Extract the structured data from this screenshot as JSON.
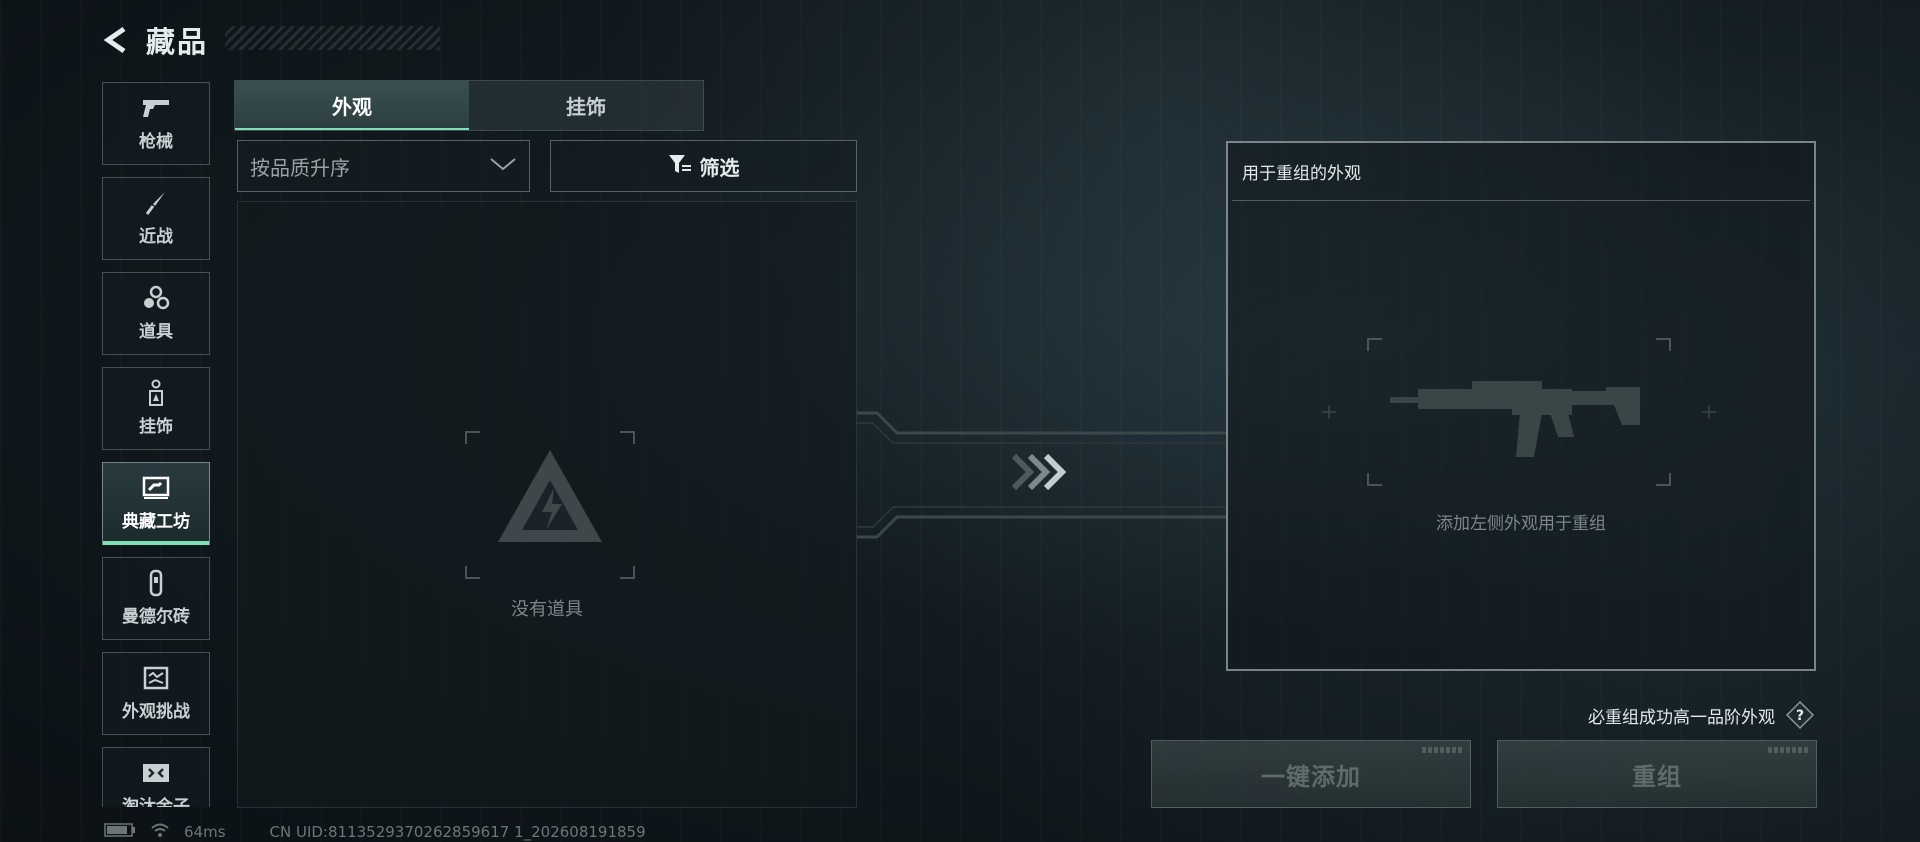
{
  "header": {
    "title": "藏品"
  },
  "sidebar": {
    "items": [
      {
        "label": "枪械",
        "icon": "pistol-icon"
      },
      {
        "label": "近战",
        "icon": "knife-icon"
      },
      {
        "label": "道具",
        "icon": "grenade-icon"
      },
      {
        "label": "挂饰",
        "icon": "charm-icon"
      },
      {
        "label": "典藏工坊",
        "icon": "workshop-icon",
        "active": true
      },
      {
        "label": "曼德尔砖",
        "icon": "brick-icon"
      },
      {
        "label": "外观挑战",
        "icon": "challenge-icon"
      },
      {
        "label": "淘汰余子",
        "icon": "elimination-icon"
      }
    ]
  },
  "tabs": [
    {
      "label": "外观",
      "active": true
    },
    {
      "label": "挂饰",
      "active": false
    }
  ],
  "sort": {
    "value": "按品质升序"
  },
  "filter": {
    "label": "筛选"
  },
  "list": {
    "empty_text": "没有道具"
  },
  "recompose": {
    "title": "用于重组的外观",
    "hint": "添加左侧外观用于重组",
    "guarantee": "必重组成功高一品阶外观"
  },
  "actions": {
    "add_all": "一键添加",
    "recompose": "重组"
  },
  "status": {
    "ping": "64ms",
    "uid": "CN UID:8113529370262859617 1_202608191859"
  },
  "colors": {
    "accent": "#7fe0b5"
  }
}
